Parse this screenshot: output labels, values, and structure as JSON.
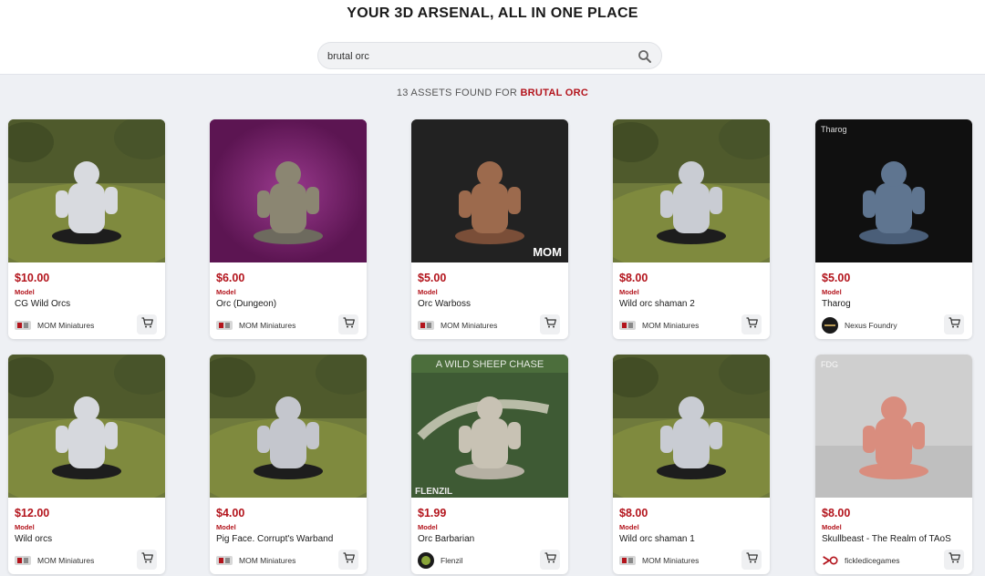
{
  "header": {
    "title": "YOUR 3D ARSENAL, ALL IN ONE PLACE",
    "search_value": "brutal orc",
    "search_icon": "search-icon"
  },
  "results": {
    "prefix": "13 ASSETS FOUND FOR",
    "query": "BRUTAL ORC"
  },
  "colors": {
    "accent": "#b3141c",
    "page_bg": "#eef0f4"
  },
  "cards": [
    {
      "price": "$10.00",
      "type": "Model",
      "name": "CG Wild Orcs",
      "seller": "MOM Miniatures",
      "logo": "mom",
      "scene": "grass",
      "mini": "#d8dadf",
      "base": "#1d1d1d",
      "banner": "",
      "corner": ""
    },
    {
      "price": "$6.00",
      "type": "Model",
      "name": "Orc (Dungeon)",
      "seller": "MOM Miniatures",
      "logo": "mom",
      "scene": "purple",
      "mini": "#8b8672",
      "base": "#6d6a5e",
      "banner": "",
      "corner": ""
    },
    {
      "price": "$5.00",
      "type": "Model",
      "name": "Orc Warboss",
      "seller": "MOM Miniatures",
      "logo": "mom",
      "scene": "dark",
      "mini": "#9c6a4d",
      "base": "#7a4e38",
      "banner": "",
      "corner": "MOM"
    },
    {
      "price": "$8.00",
      "type": "Model",
      "name": "Wild orc shaman 2",
      "seller": "MOM Miniatures",
      "logo": "mom",
      "scene": "grass",
      "mini": "#c9ccd3",
      "base": "#1d1d1d",
      "banner": "",
      "corner": ""
    },
    {
      "price": "$5.00",
      "type": "Model",
      "name": "Tharog",
      "seller": "Nexus Foundry",
      "logo": "nexus",
      "scene": "black",
      "mini": "#5f7590",
      "base": "#4a5e78",
      "banner": "Tharog",
      "corner": ""
    },
    {
      "price": "$12.00",
      "type": "Model",
      "name": "Wild orcs",
      "seller": "MOM Miniatures",
      "logo": "mom",
      "scene": "grass",
      "mini": "#d6d8dd",
      "base": "#1d1d1d",
      "banner": "",
      "corner": ""
    },
    {
      "price": "$4.00",
      "type": "Model",
      "name": "Pig Face. Corrupt's Warband",
      "seller": "MOM Miniatures",
      "logo": "mom",
      "scene": "grass",
      "mini": "#c4c6cd",
      "base": "#1d1d1d",
      "banner": "",
      "corner": ""
    },
    {
      "price": "$1.99",
      "type": "Model",
      "name": "Orc Barbarian",
      "seller": "Flenzil",
      "logo": "flenzil",
      "scene": "green",
      "mini": "#c8c2b4",
      "base": "#b5b0a3",
      "banner": "A WILD SHEEP CHASE",
      "corner": "FLENZIL"
    },
    {
      "price": "$8.00",
      "type": "Model",
      "name": "Wild orc shaman 1",
      "seller": "MOM Miniatures",
      "logo": "mom",
      "scene": "grass",
      "mini": "#c9ccd3",
      "base": "#1d1d1d",
      "banner": "",
      "corner": ""
    },
    {
      "price": "$8.00",
      "type": "Model",
      "name": "Skullbeast - The Realm of TAoS",
      "seller": "fickledicegames",
      "logo": "fdg",
      "scene": "grey",
      "mini": "#d98d7e",
      "base": "#d98d7e",
      "banner": "FDG",
      "corner": ""
    }
  ]
}
